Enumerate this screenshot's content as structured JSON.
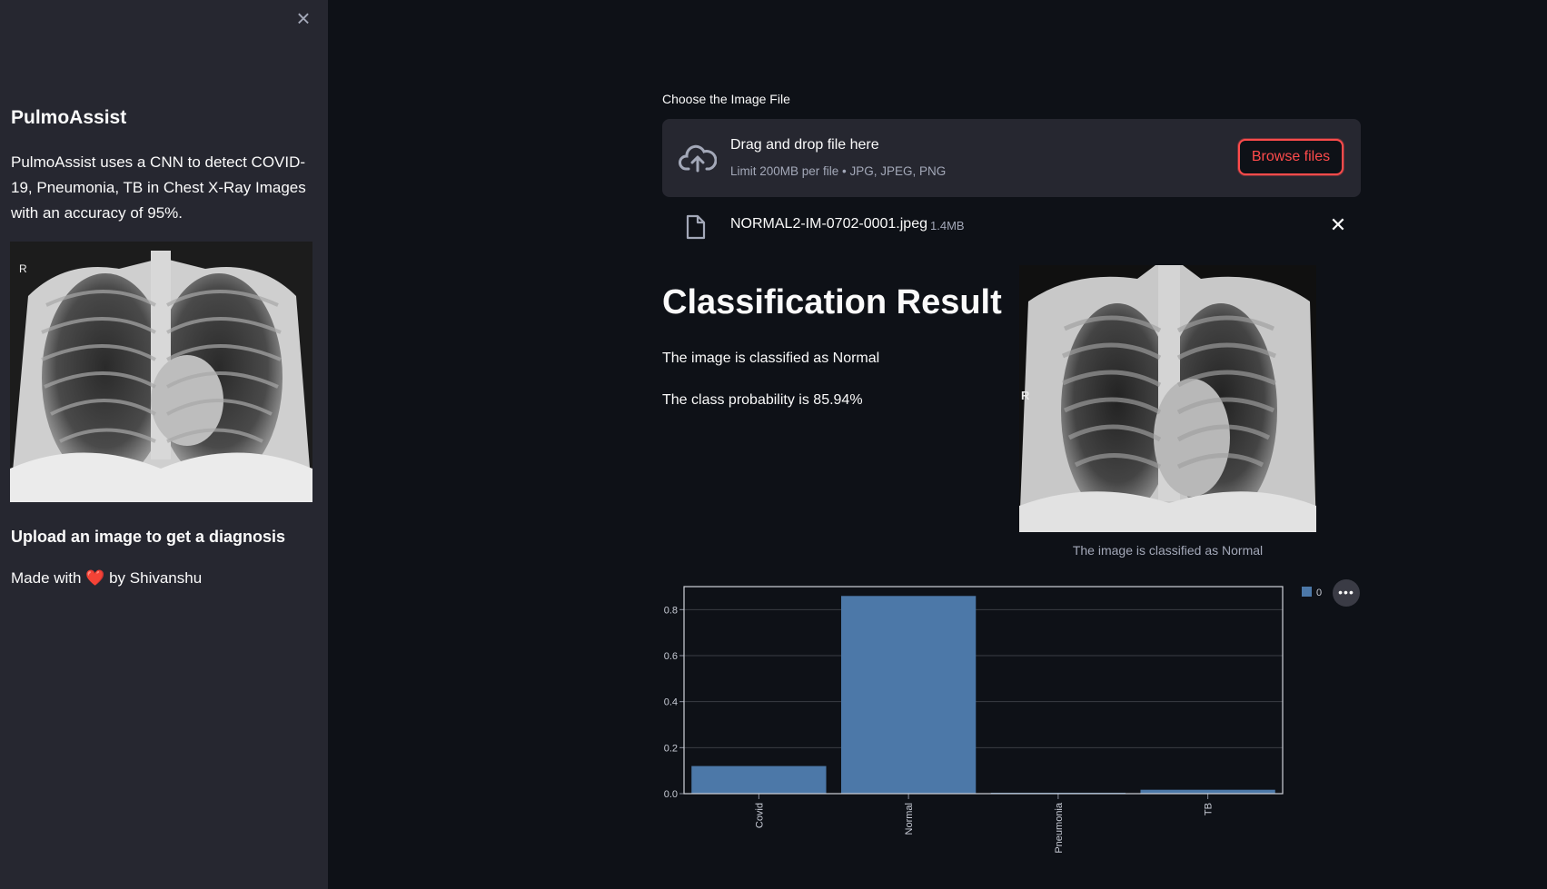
{
  "sidebar": {
    "close_icon": "×",
    "title": "PulmoAssist",
    "description": "PulmoAssist uses a CNN to detect COVID-19, Pneumonia, TB in Chest X-Ray Images with an accuracy of 95%.",
    "upload_hint": "Upload an image to get a diagnosis",
    "made_with_prefix": "Made with ",
    "heart": "❤️",
    "made_with_suffix": " by Shivanshu"
  },
  "uploader": {
    "label": "Choose the Image File",
    "dropzone_title": "Drag and drop file here",
    "dropzone_limit": "Limit 200MB per file • JPG, JPEG, PNG",
    "browse_label": "Browse files",
    "file_name": "NORMAL2-IM-0702-0001.jpeg",
    "file_size": "1.4MB",
    "remove_icon": "✕"
  },
  "result": {
    "title": "Classification Result",
    "line1": "The image is classified as Normal",
    "line2": "The class probability is 85.94%",
    "image_caption": "The image is classified as Normal",
    "side_marker": "R"
  },
  "sidebar_image": {
    "side_marker": "R"
  },
  "chart_menu_icon": "•••",
  "chart_data": {
    "type": "bar",
    "categories": [
      "Covid",
      "Normal",
      "Pneumonia",
      "TB"
    ],
    "series": [
      {
        "name": "0",
        "values": [
          0.12,
          0.8594,
          0.003,
          0.017
        ],
        "color": "#4c78a8"
      }
    ],
    "yticks": [
      "0.0",
      "0.2",
      "0.4",
      "0.6",
      "0.8"
    ],
    "ylim": [
      0,
      0.9
    ],
    "grid": true,
    "legend": "top-right"
  }
}
